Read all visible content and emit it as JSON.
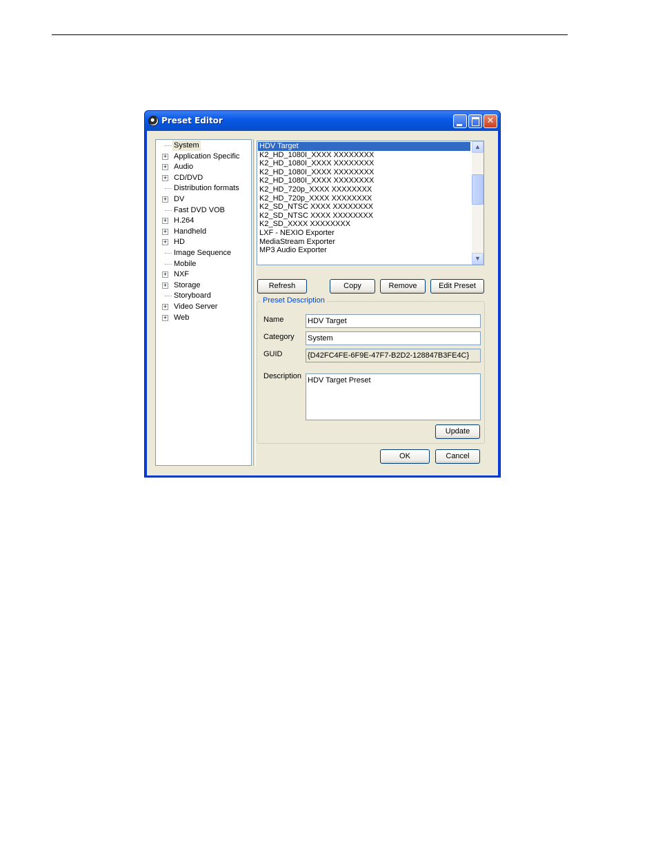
{
  "window": {
    "title": "Preset Editor",
    "controls": {
      "minimize": "_",
      "maximize": "□",
      "close": "✕"
    }
  },
  "tree": {
    "items": [
      {
        "label": "System",
        "expandable": false,
        "selected": true
      },
      {
        "label": "Application Specific",
        "expandable": true
      },
      {
        "label": "Audio",
        "expandable": true
      },
      {
        "label": "CD/DVD",
        "expandable": true
      },
      {
        "label": "Distribution formats",
        "expandable": false
      },
      {
        "label": "DV",
        "expandable": true
      },
      {
        "label": "Fast DVD VOB",
        "expandable": false
      },
      {
        "label": "H.264",
        "expandable": true
      },
      {
        "label": "Handheld",
        "expandable": true
      },
      {
        "label": "HD",
        "expandable": true
      },
      {
        "label": "Image Sequence",
        "expandable": false
      },
      {
        "label": "Mobile",
        "expandable": false
      },
      {
        "label": "NXF",
        "expandable": true
      },
      {
        "label": "Storage",
        "expandable": true
      },
      {
        "label": "Storyboard",
        "expandable": false
      },
      {
        "label": "Video Server",
        "expandable": true
      },
      {
        "label": "Web",
        "expandable": true
      }
    ]
  },
  "preset_list": {
    "items": [
      "HDV Target",
      "K2_HD_1080I_XXXX XXXXXXXX",
      "K2_HD_1080I_XXXX XXXXXXXX",
      "K2_HD_1080I_XXXX XXXXXXXX",
      "K2_HD_1080I_XXXX XXXXXXXX",
      "K2_HD_720p_XXXX XXXXXXXX",
      "K2_HD_720p_XXXX XXXXXXXX",
      "K2_SD_NTSC XXXX XXXXXXXX",
      "K2_SD_NTSC XXXX XXXXXXXX",
      "K2_SD_XXXX XXXXXXXX",
      "LXF - NEXIO Exporter",
      "MediaStream Exporter",
      "MP3 Audio Exporter"
    ],
    "selected_index": 0
  },
  "buttons": {
    "refresh": "Refresh",
    "copy": "Copy",
    "remove": "Remove",
    "edit_preset": "Edit Preset",
    "update": "Update",
    "ok": "OK",
    "cancel": "Cancel"
  },
  "description_group": {
    "title": "Preset Description",
    "name_label": "Name",
    "name_value": "HDV Target",
    "category_label": "Category",
    "category_value": "System",
    "guid_label": "GUID",
    "guid_value": "{D42FC4FE-6F9E-47F7-B2D2-128847B3FE4C}",
    "description_label": "Description",
    "description_value": "HDV Target Preset"
  },
  "colors": {
    "titlebar": "#0553d8",
    "selection": "#316ac5",
    "dialog_bg": "#ece9d8",
    "group_title": "#0046d5"
  }
}
